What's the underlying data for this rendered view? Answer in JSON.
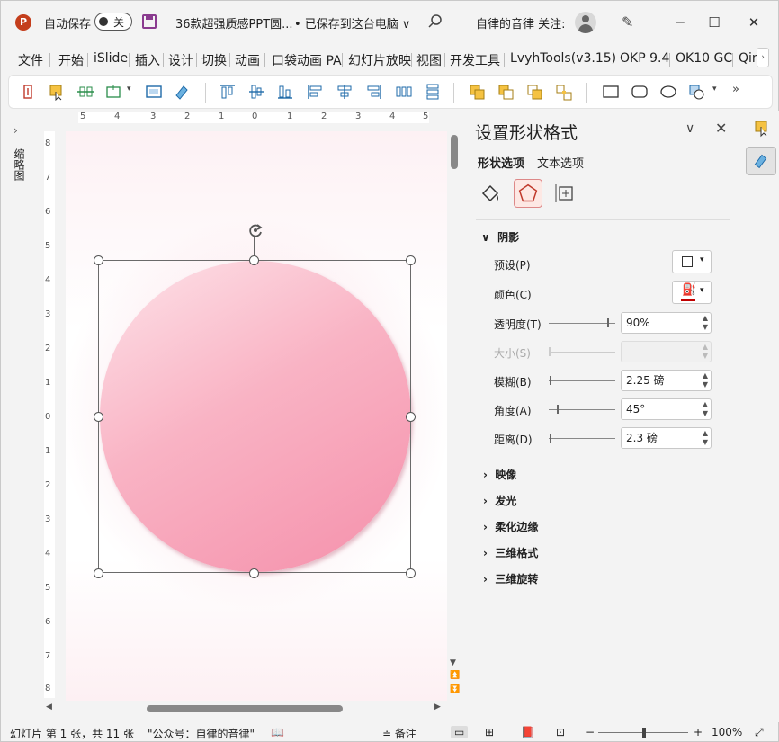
{
  "titlebar": {
    "autosave_label": "自动保存",
    "autosave_state": "关",
    "doc_title": "36款超强质感PPT圆...",
    "save_status": "• 已保存到这台电脑 ∨",
    "user_name": "自律的音律 关注:",
    "minimize": "─",
    "maximize": "☐",
    "close": "✕",
    "app_icon": "P"
  },
  "menu": {
    "items": [
      "文件",
      "开始",
      "iSlide",
      "插入",
      "设计",
      "切换",
      "动画",
      "口袋动画 PA",
      "幻灯片放映",
      "视图",
      "开发工具",
      "LvyhTools(v3.15)",
      "OKP 9.4",
      "OK10 GC",
      "Qin"
    ],
    "scroll": "›"
  },
  "toolbar": {
    "more": "»"
  },
  "left_pane": {
    "toggle": "›",
    "label": "缩略图"
  },
  "ruler": {
    "h_labels": [
      "5",
      "4",
      "3",
      "2",
      "1",
      "0",
      "1",
      "2",
      "3",
      "4",
      "5"
    ],
    "v_labels": [
      "8",
      "7",
      "6",
      "5",
      "4",
      "3",
      "2",
      "1",
      "0",
      "1",
      "2",
      "3",
      "4",
      "5",
      "6",
      "7",
      "8"
    ]
  },
  "panel": {
    "title": "设置形状格式",
    "tabs": [
      "形状选项",
      "文本选项"
    ],
    "section_open": "阴影",
    "rows": [
      {
        "label": "预设(P)",
        "type": "dropdown"
      },
      {
        "label": "颜色(C)",
        "type": "color"
      },
      {
        "label": "透明度(T)",
        "value": "90%",
        "slider": 0.9,
        "disabled": false
      },
      {
        "label": "大小(S)",
        "value": "",
        "slider": 0,
        "disabled": true
      },
      {
        "label": "模糊(B)",
        "value": "2.25 磅",
        "slider": 0.02,
        "disabled": false
      },
      {
        "label": "角度(A)",
        "value": "45°",
        "slider": 0.12,
        "disabled": false
      },
      {
        "label": "距离(D)",
        "value": "2.3 磅",
        "slider": 0.01,
        "disabled": false
      }
    ],
    "collapsed_sections": [
      "映像",
      "发光",
      "柔化边缘",
      "三维格式",
      "三维旋转"
    ],
    "chevron": "∨",
    "close": "✕"
  },
  "statusbar": {
    "slide_info": "幻灯片 第 1 张，共 11 张",
    "template": "\"公众号：自律的音律\"",
    "notes": "备注",
    "zoom": "100%",
    "zoom_level": 1.0,
    "minus": "−",
    "plus": "+"
  },
  "colors": {
    "accent": "#c43e1c",
    "shape_light": "#fde3e9",
    "shape_dark": "#f590ab",
    "shadow_color": "#c00000"
  }
}
